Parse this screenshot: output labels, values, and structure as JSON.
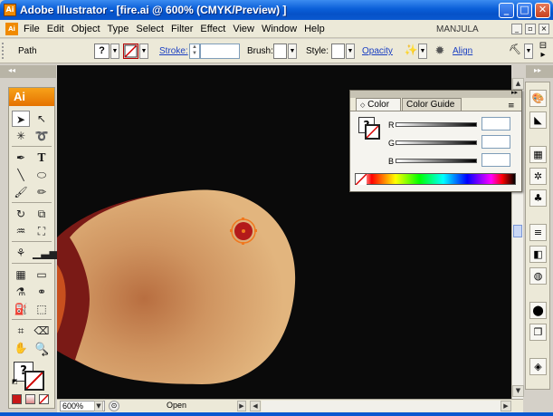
{
  "window": {
    "title": "Adobe Illustrator - [fire.ai @ 600% (CMYK/Preview) ]",
    "minimize": "_",
    "maximize": "□",
    "close": "✕"
  },
  "app_icon": "Ai",
  "menu": {
    "items": [
      "File",
      "Edit",
      "Object",
      "Type",
      "Select",
      "Filter",
      "Effect",
      "View",
      "Window",
      "Help"
    ],
    "user": "MANJULA"
  },
  "control_bar": {
    "selection_label": "Path",
    "stroke_label": "Stroke:",
    "stroke_value": "",
    "brush_label": "Brush:",
    "style_label": "Style:",
    "opacity_label": "Opacity",
    "align_label": "Align"
  },
  "tools": {
    "badge": "Ai",
    "type_glyph": "T"
  },
  "color_panel": {
    "tab_color": "Color",
    "tab_close": "✕",
    "tab_guide": "Color Guide",
    "channels": [
      {
        "label": "R",
        "value": ""
      },
      {
        "label": "G",
        "value": ""
      },
      {
        "label": "B",
        "value": ""
      }
    ]
  },
  "status": {
    "zoom": "600%",
    "text": "Open"
  },
  "colors": {
    "accent": "#f08a00",
    "titlebar": "#0a58d0",
    "egg_light": "#e4b47e",
    "egg_dark": "#b86e40",
    "egg_rim": "#7a1a16",
    "selected_dot": "#b31a1a"
  }
}
